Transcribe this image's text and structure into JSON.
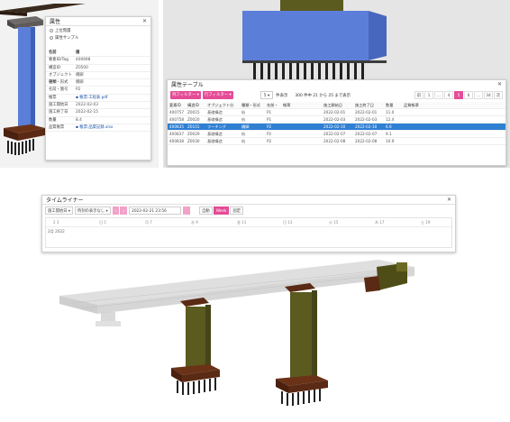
{
  "colors": {
    "accent": "#e44c97",
    "selection": "#2f7fd3",
    "column_blue": "#5b7fd9",
    "pier_olive": "#5b5a1f",
    "footing_brown": "#5a2a14"
  },
  "property_panel": {
    "title": "属性",
    "radio_1": "上位階層",
    "radio_2": "属性サンプル",
    "header": {
      "key": "名前",
      "value": "値"
    },
    "rows": [
      {
        "key": "要素ID/Tag",
        "value": "400698",
        "link": false
      },
      {
        "key": "構造ID",
        "value": "Z0500",
        "link": false
      },
      {
        "key": "オブジェクト分類",
        "value": "橋脚",
        "link": false
      },
      {
        "key": "種類・形式",
        "value": "橋脚",
        "link": false
      },
      {
        "key": "名前・箇号",
        "value": "P2",
        "link": false
      },
      {
        "key": "帳票",
        "value": "帳票:工程表.pdf",
        "link": true
      },
      {
        "key": "施工開始日",
        "value": "2022-02-03",
        "link": false
      },
      {
        "key": "施工終了日",
        "value": "2022-02-15",
        "link": false
      },
      {
        "key": "数量",
        "value": "8.4",
        "link": false
      },
      {
        "key": "品質帳票",
        "value": "帳票:品質記録.xlsx",
        "link": true
      }
    ]
  },
  "table_panel": {
    "title": "属性テーブル",
    "filter_1": "列フィルター",
    "filter_2": "行フィルター",
    "per_page_value": "5",
    "per_page_label": "件表示",
    "count_text": "300 件中 21 から 25 まで表示",
    "pagination": [
      "前",
      "1",
      "…",
      "4",
      "5",
      "6",
      "…",
      "34",
      "次"
    ],
    "active_page": "5",
    "columns": [
      "要素ID",
      "構造ID",
      "オブジェクト分",
      "種類・形式",
      "名前・",
      "帳票",
      "施工開始日",
      "施工終了日",
      "数量",
      "品質帳票"
    ],
    "rows": [
      [
        "400757",
        "Z0015",
        "基礎構造",
        "杭",
        "P1",
        "",
        "2022-02-01",
        "2022-02-01",
        "11.0",
        ""
      ],
      [
        "400758",
        "Z0020",
        "基礎構造",
        "杭",
        "P1",
        "",
        "2022-02-03",
        "2022-02-03",
        "12.4",
        ""
      ],
      [
        "400835",
        "Z0101",
        "フーチング",
        "橋脚",
        "P2",
        "",
        "2022-02-10",
        "2022-02-10",
        "6.6",
        ""
      ],
      [
        "400837",
        "Z0029",
        "基礎構造",
        "杭",
        "P2",
        "",
        "2022-02-07",
        "2022-02-07",
        "9.1",
        ""
      ],
      [
        "400838",
        "Z0030",
        "基礎構造",
        "杭",
        "P2",
        "",
        "2022-02-08",
        "2022-02-08",
        "10.9",
        ""
      ]
    ],
    "selected_row": 2
  },
  "timeliner": {
    "title": "タイムライナー",
    "select_1": "施工開始日",
    "select_2": "時刻の表示なし",
    "prev_icon": "chevron-left-icon",
    "next_icon": "chevron-right-icon",
    "datetime": "2022-02-21 23:56",
    "btn_auto": "自動",
    "btn_week": "Week",
    "btn_fix": "固定",
    "ticks": [
      "3",
      "5",
      "7",
      "9",
      "11",
      "13",
      "15",
      "17"
    ],
    "tick_dates": [
      "2 3",
      "日 5",
      "月 7",
      "水 9",
      "金 11",
      "日 13",
      "火 15",
      "木 17",
      "土 19"
    ],
    "month_label": "2月 2022"
  }
}
